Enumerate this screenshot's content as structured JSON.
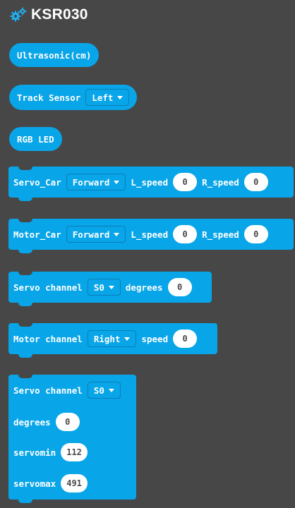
{
  "header": {
    "title": "KSR030",
    "icon": "gears-icon"
  },
  "blocks": {
    "ultrasonic": {
      "label": "Ultrasonic(cm)"
    },
    "track_sensor": {
      "label": "Track Sensor",
      "side": "Left"
    },
    "rgb_led": {
      "label": "RGB LED"
    },
    "servo_car": {
      "label": "Servo_Car",
      "direction": "Forward",
      "l_label": "L_speed",
      "l_value": "0",
      "r_label": "R_speed",
      "r_value": "0"
    },
    "motor_car": {
      "label": "Motor_Car",
      "direction": "Forward",
      "l_label": "L_speed",
      "l_value": "0",
      "r_label": "R_speed",
      "r_value": "0"
    },
    "servo_channel": {
      "label": "Servo channel",
      "channel": "S0",
      "deg_label": "degrees",
      "deg_value": "0"
    },
    "motor_channel": {
      "label": "Motor channel",
      "channel": "Right",
      "speed_label": "speed",
      "speed_value": "0"
    },
    "servo_channel_range": {
      "label": "Servo channel",
      "channel": "S0",
      "deg_label": "degrees",
      "deg_value": "0",
      "min_label": "servomin",
      "min_value": "112",
      "max_label": "servomax",
      "max_value": "491"
    }
  },
  "colors": {
    "background": "#474747",
    "block": "#08a5e8",
    "field_text": "#4a4a4a"
  }
}
